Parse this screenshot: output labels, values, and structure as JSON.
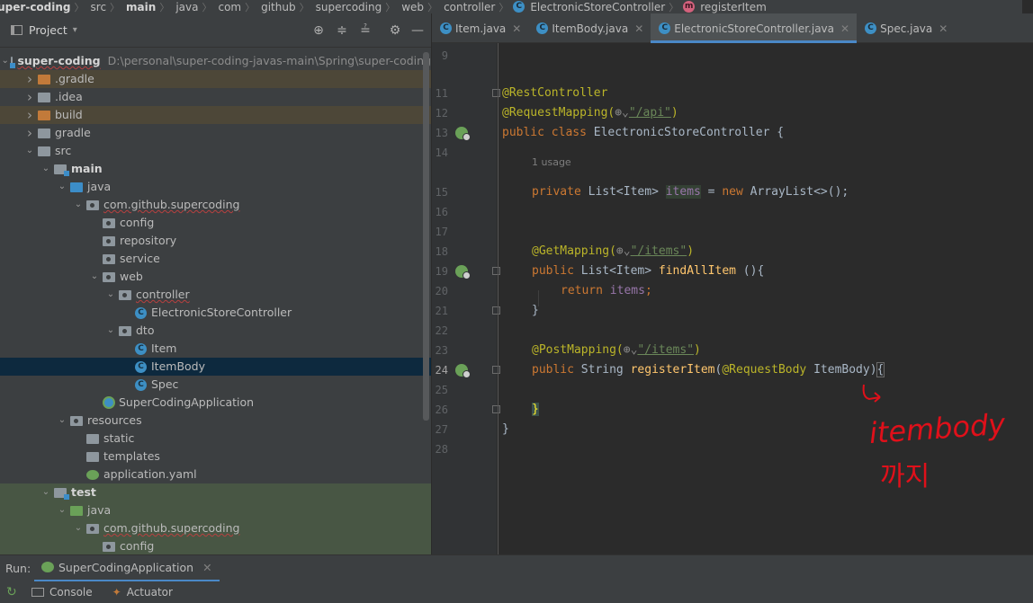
{
  "breadcrumb": {
    "items": [
      "super-coding",
      "src",
      "main",
      "java",
      "com",
      "github",
      "supercoding",
      "web",
      "controller",
      "ElectronicStoreController",
      "registerItem"
    ]
  },
  "project_panel": {
    "title": "Project",
    "tree": [
      {
        "label": "super-coding",
        "path": "D:\\personal\\super-coding-javas-main\\Spring\\super-coding",
        "indent": 0,
        "arrow": "down",
        "icon": "module-folder",
        "style": ""
      },
      {
        "label": ".gradle",
        "indent": 1,
        "arrow": "right",
        "icon": "folder-orange",
        "style": "tan"
      },
      {
        "label": ".idea",
        "indent": 1,
        "arrow": "right",
        "icon": "folder",
        "style": ""
      },
      {
        "label": "build",
        "indent": 1,
        "arrow": "right",
        "icon": "folder-orange",
        "style": "tan"
      },
      {
        "label": "gradle",
        "indent": 1,
        "arrow": "right",
        "icon": "folder",
        "style": ""
      },
      {
        "label": "src",
        "indent": 1,
        "arrow": "down",
        "icon": "folder",
        "style": ""
      },
      {
        "label": "main",
        "indent": 2,
        "arrow": "down",
        "icon": "folder-sq",
        "style": "bold"
      },
      {
        "label": "java",
        "indent": 3,
        "arrow": "down",
        "icon": "folder-blue",
        "style": ""
      },
      {
        "label": "com.github.supercoding",
        "indent": 4,
        "arrow": "down",
        "icon": "package",
        "style": ""
      },
      {
        "label": "config",
        "indent": 5,
        "arrow": "",
        "icon": "package",
        "style": ""
      },
      {
        "label": "repository",
        "indent": 5,
        "arrow": "",
        "icon": "package",
        "style": ""
      },
      {
        "label": "service",
        "indent": 5,
        "arrow": "",
        "icon": "package",
        "style": ""
      },
      {
        "label": "web",
        "indent": 5,
        "arrow": "down",
        "icon": "package",
        "style": ""
      },
      {
        "label": "controller",
        "indent": 6,
        "arrow": "down",
        "icon": "package",
        "style": ""
      },
      {
        "label": "ElectronicStoreController",
        "indent": 7,
        "arrow": "",
        "icon": "class",
        "style": ""
      },
      {
        "label": "dto",
        "indent": 6,
        "arrow": "down",
        "icon": "package",
        "style": ""
      },
      {
        "label": "Item",
        "indent": 7,
        "arrow": "",
        "icon": "class",
        "style": ""
      },
      {
        "label": "ItemBody",
        "indent": 7,
        "arrow": "",
        "icon": "class",
        "style": "sel"
      },
      {
        "label": "Spec",
        "indent": 7,
        "arrow": "",
        "icon": "class",
        "style": ""
      },
      {
        "label": "SuperCodingApplication",
        "indent": 5,
        "arrow": "",
        "icon": "spring-class",
        "style": ""
      },
      {
        "label": "resources",
        "indent": 3,
        "arrow": "down",
        "icon": "folder-res",
        "style": ""
      },
      {
        "label": "static",
        "indent": 4,
        "arrow": "",
        "icon": "folder",
        "style": ""
      },
      {
        "label": "templates",
        "indent": 4,
        "arrow": "",
        "icon": "folder",
        "style": ""
      },
      {
        "label": "application.yaml",
        "indent": 4,
        "arrow": "",
        "icon": "yaml",
        "style": ""
      },
      {
        "label": "test",
        "indent": 2,
        "arrow": "down",
        "icon": "folder-sq",
        "style": "bold green"
      },
      {
        "label": "java",
        "indent": 3,
        "arrow": "down",
        "icon": "folder-green",
        "style": "green"
      },
      {
        "label": "com.github.supercoding",
        "indent": 4,
        "arrow": "down",
        "icon": "package",
        "style": "green"
      },
      {
        "label": "config",
        "indent": 5,
        "arrow": "",
        "icon": "package",
        "style": "green"
      }
    ]
  },
  "editor": {
    "tabs": [
      {
        "label": "Item.java",
        "active": false
      },
      {
        "label": "ItemBody.java",
        "active": false
      },
      {
        "label": "ElectronicStoreController.java",
        "active": true
      },
      {
        "label": "Spec.java",
        "active": false
      }
    ],
    "line_numbers": [
      "9",
      "11",
      "12",
      "13",
      "14",
      "15",
      "16",
      "17",
      "18",
      "19",
      "20",
      "21",
      "22",
      "23",
      "24",
      "25",
      "26",
      "27",
      "28"
    ],
    "usage_hint": "1 usage",
    "code": {
      "l11": "@RestController",
      "l12_a": "@RequestMapping(",
      "l12_b": "\"/api\"",
      "l12_c": ")",
      "l13_kw": "public class",
      "l13_rest": " ElectronicStoreController {",
      "l15_kw": "private",
      "l15_type": " List<Item> ",
      "l15_field": "items",
      "l15_eq": " = ",
      "l15_new": "new",
      "l15_rest": " ArrayList<>();",
      "l18_a": "@GetMapping(",
      "l18_b": "\"/items\"",
      "l18_c": ")",
      "l19_kw": "public",
      "l19_type": " List<Item> ",
      "l19_fn": "findAllItem",
      "l19_rest": " (){",
      "l20_kw": "return",
      "l20_field": " items",
      "l20_rest": ";",
      "l21": "}",
      "l23_a": "@PostMapping(",
      "l23_b": "\"/items\"",
      "l23_c": ")",
      "l24_kw": "public",
      "l24_type": " String ",
      "l24_fn": "registerItem",
      "l24_p1": "(",
      "l24_annot": "@RequestBody",
      "l24_rest": " ItemBody)",
      "l24_brace": "{",
      "l26": "}",
      "l27": "}"
    }
  },
  "handwriting": {
    "line1": "itembody",
    "line2": "까지"
  },
  "run_bar": {
    "label": "Run:",
    "tab": "SuperCodingApplication"
  },
  "console_bar": {
    "console": "Console",
    "actuator": "Actuator"
  },
  "colors": {
    "panel_bg": "#3c3f41",
    "editor_bg": "#2b2b2b",
    "gutter_bg": "#313335",
    "selection": "#0d293e",
    "accent": "#4a88c7",
    "annotation": "#bbb529",
    "keyword": "#cc7832",
    "string": "#6a8759",
    "field": "#9876aa",
    "function": "#ffc66d",
    "handwriting": "#e0101a"
  }
}
